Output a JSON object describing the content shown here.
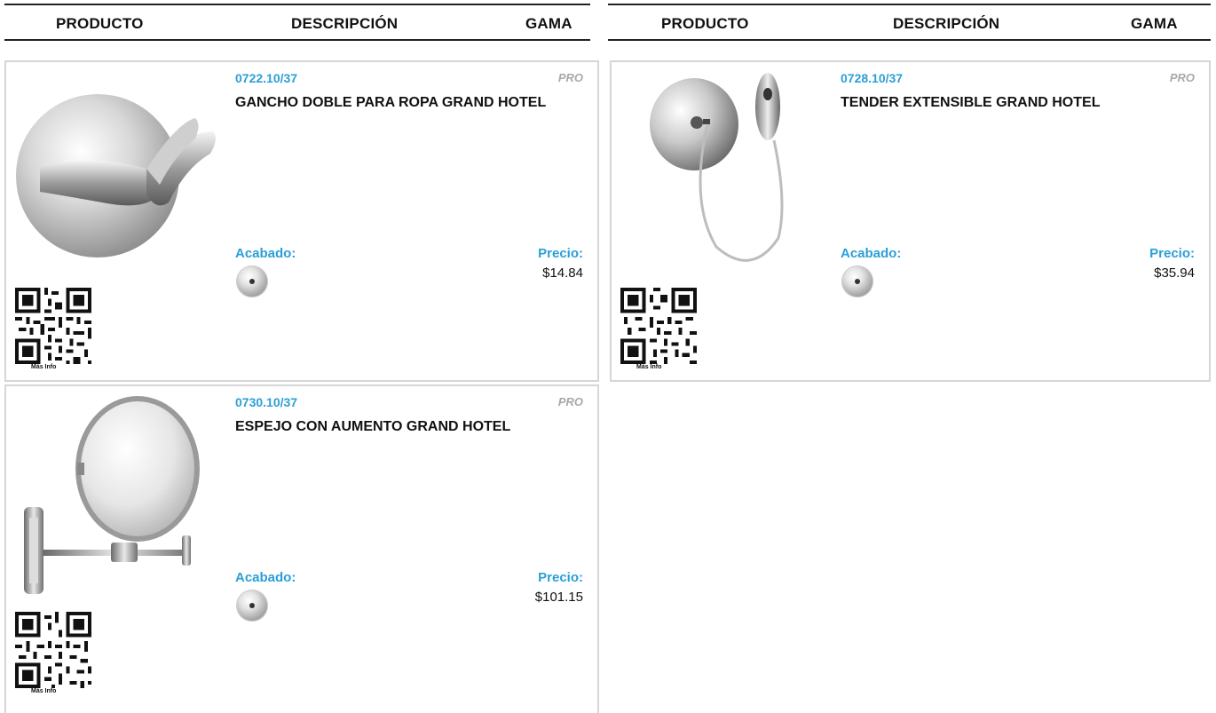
{
  "header": {
    "columns": [
      "PRODUCTO",
      "DESCRIPCIÓN",
      "GAMA",
      "PRODUCTO",
      "DESCRIPCIÓN",
      "GAMA"
    ]
  },
  "products": [
    {
      "code": "0722.10/37",
      "gama": "PRO",
      "name": "GANCHO DOBLE PARA ROPA GRAND HOTEL",
      "acabado_label": "Acabado:",
      "precio_label": "Precio:",
      "price": "$14.84",
      "qr_label": "Más Info",
      "image_icon": "double-hook-icon",
      "finish_icon": "chrome-finish-swatch-icon"
    },
    {
      "code": "0728.10/37",
      "gama": "PRO",
      "name": "TENDER EXTENSIBLE GRAND HOTEL",
      "acabado_label": "Acabado:",
      "precio_label": "Precio:",
      "price": "$35.94",
      "qr_label": "Más Info",
      "image_icon": "retractable-clothesline-icon",
      "finish_icon": "chrome-finish-swatch-icon"
    },
    {
      "code": "0730.10/37",
      "gama": "PRO",
      "name": "ESPEJO CON AUMENTO GRAND HOTEL",
      "acabado_label": "Acabado:",
      "precio_label": "Precio:",
      "price": "$101.15",
      "qr_label": "Más Info",
      "image_icon": "magnifying-mirror-icon",
      "finish_icon": "chrome-finish-swatch-icon"
    }
  ],
  "colors": {
    "accent": "#2b9fd6",
    "gama": "#a9a9a9",
    "border": "#d6d6d6"
  }
}
